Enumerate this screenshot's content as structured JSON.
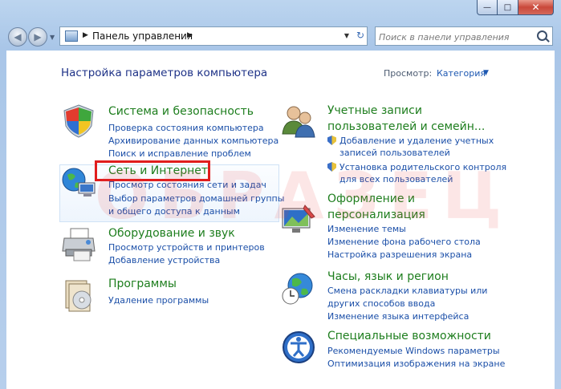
{
  "window": {
    "minimize": "—",
    "maximize": "□",
    "close": "✕"
  },
  "navbar": {
    "back": "◀",
    "forward": "▶",
    "history": "▼",
    "breadcrumb_sep": "▶",
    "address": "Панель управления",
    "address_drop": "▼",
    "refresh": "↻",
    "search_placeholder": "Поиск в панели управления"
  },
  "header": {
    "title": "Настройка параметров компьютера",
    "view_label": "Просмотр:",
    "view_value": "Категория",
    "view_arrow": "▼"
  },
  "watermark": "ОБРАЗЕЦ",
  "categories": {
    "system": {
      "title": "Система и безопасность",
      "links": [
        "Проверка состояния компьютера",
        "Архивирование данных компьютера",
        "Поиск и исправление проблем"
      ]
    },
    "network": {
      "title": "Сеть и Интернет",
      "links": [
        "Просмотр состояния сети и задач",
        "Выбор параметров домашней группы",
        "и общего доступа к данным"
      ]
    },
    "hardware": {
      "title": "Оборудование и звук",
      "links": [
        "Просмотр устройств и принтеров",
        "Добавление устройства"
      ]
    },
    "programs": {
      "title": "Программы",
      "links": [
        "Удаление программы"
      ]
    },
    "users": {
      "title_line1": "Учетные записи",
      "title_line2": "пользователей и семейн...",
      "links": [
        "Добавление и удаление учетных",
        "записей пользователей",
        "Установка родительского контроля",
        "для всех пользователей"
      ]
    },
    "appearance": {
      "title_line1": "Оформление и",
      "title_line2": "персонализация",
      "links": [
        "Изменение темы",
        "Изменение фона рабочего стола",
        "Настройка разрешения экрана"
      ]
    },
    "clock": {
      "title": "Часы, язык и регион",
      "links": [
        "Смена раскладки клавиатуры или",
        "других способов ввода",
        "Изменение языка интерфейса"
      ]
    },
    "access": {
      "title": "Специальные возможности",
      "links": [
        "Рекомендуемые Windows параметры",
        "Оптимизация изображения на экране"
      ]
    }
  }
}
